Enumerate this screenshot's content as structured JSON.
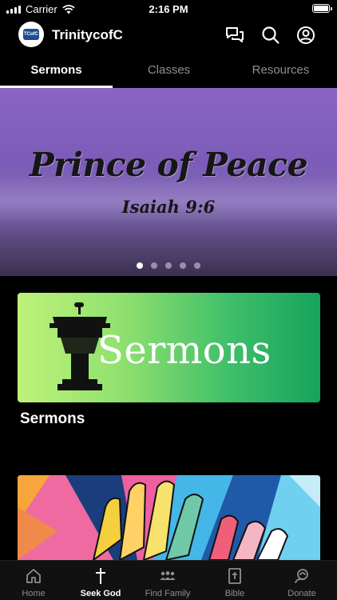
{
  "status_bar": {
    "carrier": "Carrier",
    "time": "2:16 PM"
  },
  "header": {
    "app_title": "TrinitycofC",
    "logo_text": "TCofC",
    "icons": [
      "chat-icon",
      "search-icon",
      "profile-icon"
    ]
  },
  "tabs": [
    {
      "label": "Sermons",
      "active": true
    },
    {
      "label": "Classes",
      "active": false
    },
    {
      "label": "Resources",
      "active": false
    }
  ],
  "hero": {
    "title": "Prince of Peace",
    "subtitle": "Isaiah 9:6",
    "page_count": 5,
    "active_page": 1
  },
  "cards": [
    {
      "art_text": "Sermons",
      "label": "Sermons",
      "icon": "pulpit-icon"
    },
    {
      "art_text": "",
      "label": ""
    }
  ],
  "bottom_nav": [
    {
      "label": "Home",
      "icon": "home-icon",
      "active": false
    },
    {
      "label": "Seek God",
      "icon": "cross-icon",
      "active": true
    },
    {
      "label": "Find Family",
      "icon": "people-icon",
      "active": false
    },
    {
      "label": "Bible",
      "icon": "bible-icon",
      "active": false
    },
    {
      "label": "Donate",
      "icon": "donate-icon",
      "active": false
    }
  ],
  "colors": {
    "background": "#000000",
    "tab_inactive": "#8e8e93",
    "card_gradient_start": "#bef27a",
    "card_gradient_end": "#16a35c"
  }
}
